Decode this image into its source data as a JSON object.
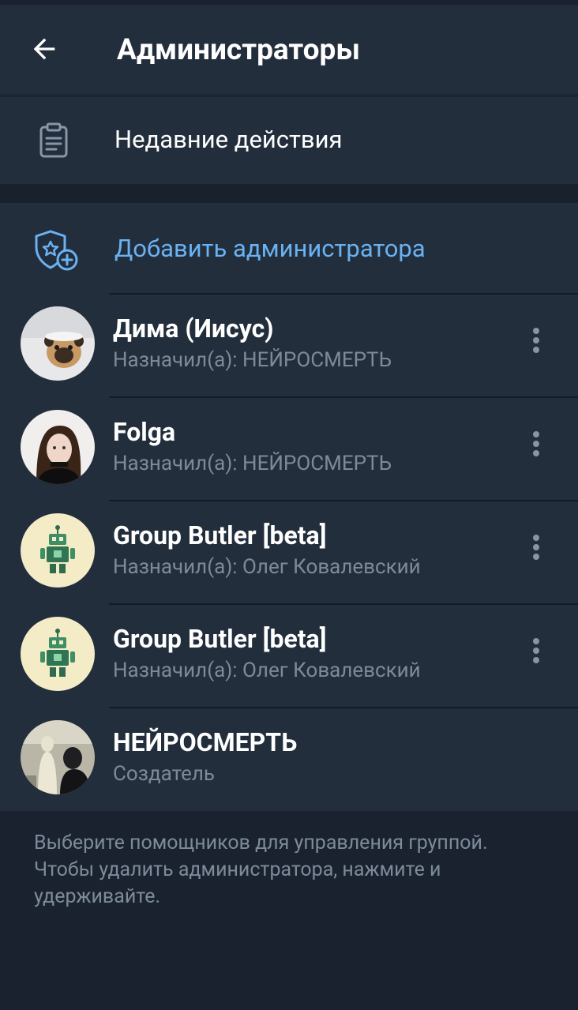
{
  "header": {
    "title": "Администраторы",
    "back_icon": "arrow-left-icon"
  },
  "recent_actions": {
    "label": "Недавние действия",
    "icon": "clipboard-icon"
  },
  "add_admin": {
    "label": "Добавить администратора",
    "icon": "shield-star-add-icon",
    "color": "#6ab2f2"
  },
  "admins": [
    {
      "name": "Дима (Иисус)",
      "subtitle": "Назначил(а): НЕЙРОСМЕРТЬ",
      "avatar": "pug-photo",
      "has_menu": true
    },
    {
      "name": "Folga",
      "subtitle": "Назначил(а): НЕЙРОСМЕРТЬ",
      "avatar": "girl-photo",
      "has_menu": true
    },
    {
      "name": "Group Butler [beta]",
      "subtitle": "Назначил(а): Олег Ковалевский",
      "avatar": "robot-icon",
      "has_menu": true
    },
    {
      "name": "Group Butler [beta]",
      "subtitle": "Назначил(а): Олег Ковалевский",
      "avatar": "robot-icon",
      "has_menu": true
    },
    {
      "name": "НЕЙРОСМЕРТЬ",
      "subtitle": "Создатель",
      "avatar": "statue-photo",
      "has_menu": false
    }
  ],
  "footer": {
    "hint": "Выберите помощников для управления группой. Чтобы удалить администратора, нажмите и удерживайте."
  },
  "colors": {
    "background": "#1a2230",
    "surface": "#232e3c",
    "accent": "#6ab2f2",
    "secondary_text": "#7d8b99"
  }
}
